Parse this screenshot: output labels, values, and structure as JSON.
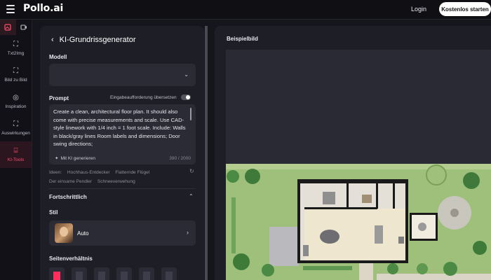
{
  "header": {
    "brand": "Pollo.ai",
    "login_label": "Login",
    "start_label": "Kostenlos starten"
  },
  "sidebar": {
    "items": [
      {
        "label": "Txt2Img",
        "icon": "image-icon"
      },
      {
        "label": "Bild zu Bild",
        "icon": "image-swap-icon"
      },
      {
        "label": "Inspiration",
        "icon": "compass-icon"
      },
      {
        "label": "Auswirkungen",
        "icon": "effects-icon"
      },
      {
        "label": "KI-Tools",
        "icon": "tools-icon",
        "active": true
      }
    ]
  },
  "panel": {
    "title": "KI-Grundrissgenerator",
    "model_label": "Modell",
    "model_value": "",
    "prompt_label": "Prompt",
    "translate_label": "Eingabeaufforderung übersetzen",
    "prompt_text": "Create a clean, architectural floor plan. It should also come with precise measurements and scale. Use CAD-style linework with 1/4 inch = 1 foot scale. Include: Walls in black/gray lines Room labels and dimensions; Door swing directions;",
    "generate_label": "Mit KI generieren",
    "counter": "390 / 2000",
    "ideas_label": "Ideen:",
    "ideas": [
      "Hochhaus-Entdecker",
      "Flatternde Flügel",
      "Der einsame Pendler",
      "Schneeverwehung"
    ],
    "advanced_label": "Fortschrittlich",
    "style_label": "Stil",
    "style_value": "Auto",
    "aspect_label": "Seitenverhältnis"
  },
  "example": {
    "title": "Beispielbild"
  },
  "colors": {
    "accent": "#ff2e5a",
    "panel": "#1e1e27",
    "background": "#15151c"
  }
}
